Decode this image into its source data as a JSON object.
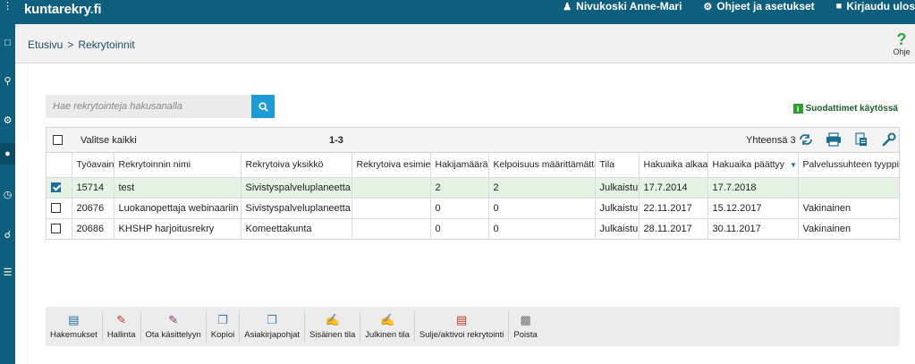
{
  "app": {
    "logo_main": "kuntarekry",
    "logo_dot": ".",
    "logo_tld": "fi",
    "accent": "#0e5f7d"
  },
  "topnav": {
    "user": "Nivukoski Anne-Mari",
    "settings": "Ohjeet ja asetukset",
    "logout": "Kirjaudu ulos"
  },
  "breadcrumb": {
    "home": "Etusivu",
    "separator": ">",
    "current": "Rekrytoinnit"
  },
  "help": {
    "label": "Ohje",
    "icon": "?"
  },
  "search": {
    "placeholder": "Hae rekrytointeja hakusanalla",
    "value": ""
  },
  "filters": {
    "label": "Suodattimet käytössä"
  },
  "grid": {
    "select_all": "Valitse kaikki",
    "range": "1-3",
    "total": "Yhteensä 3",
    "columns": [
      "Työavain",
      "Rekrytoinnin nimi",
      "Rekrytoiva yksikkö",
      "Rekrytoiva esimies",
      "Hakijamäärä",
      "Kelpoisuus määrittämättä",
      "Tila",
      "Hakuaika alkaa",
      "Hakuaika päättyy",
      "Palvelussuhteen tyyppi"
    ],
    "rows": [
      {
        "checked": true,
        "cells": [
          "15714",
          "test",
          "Sivistyspalveluplaneetta",
          "",
          "2",
          "2",
          "Julkaistu",
          "17.7.2014",
          "17.7.2018",
          ""
        ]
      },
      {
        "checked": false,
        "cells": [
          "20676",
          "Luokanopettaja webinaariin",
          "Sivistyspalveluplaneetta",
          "",
          "0",
          "0",
          "Julkaistu",
          "22.11.2017",
          "15.12.2017",
          "Vakinainen"
        ]
      },
      {
        "checked": false,
        "cells": [
          "20686",
          "KHSHP harjoitusrekry",
          "Komeettakunta",
          "",
          "0",
          "0",
          "Julkaistu",
          "28.11.2017",
          "30.11.2017",
          "Vakinainen"
        ]
      }
    ]
  },
  "toolbar": {
    "items": [
      {
        "label": "Hakemukset",
        "icon": "document-icon"
      },
      {
        "label": "Hallinta",
        "icon": "pencil-icon"
      },
      {
        "label": "Ota käsittelyyn",
        "icon": "edit-icon"
      },
      {
        "label": "Kopioi",
        "icon": "copy-icon"
      },
      {
        "label": "Asiakirjapohjat",
        "icon": "templates-icon"
      },
      {
        "label": "Sisäinen tila",
        "icon": "internal-state-icon"
      },
      {
        "label": "Julkinen tila",
        "icon": "public-state-icon"
      },
      {
        "label": "Sulje/aktivoi rekrytointi",
        "icon": "close-activate-icon"
      },
      {
        "label": "Poista",
        "icon": "trash-icon"
      }
    ]
  }
}
